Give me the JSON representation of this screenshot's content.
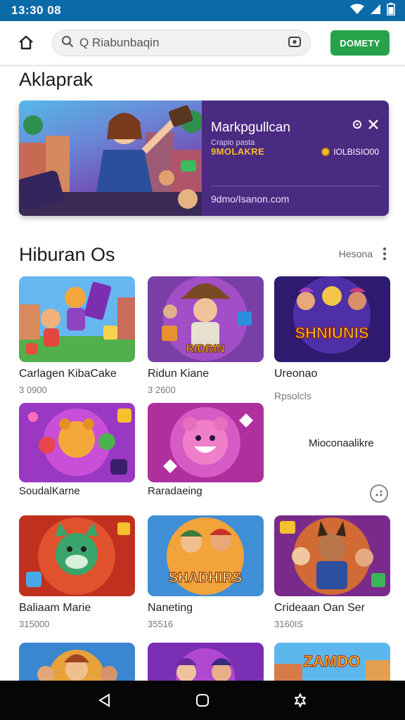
{
  "status_bar": {
    "time": "13:30 08",
    "icons": [
      "wifi-icon",
      "signal-icon",
      "battery-icon"
    ]
  },
  "app_bar": {
    "search_placeholder": "Q Riabunbaqin",
    "action_button": "DOMETY",
    "icons": [
      "home-icon",
      "search-icon",
      "camera-icon"
    ]
  },
  "featured": {
    "section_title": "Aklaprak",
    "title": "Markpgullcan",
    "subtitle": "Crapio pasta",
    "badge": "9MOLAKRE",
    "code": "IOLBISIO00",
    "link": "9dmo/Isanon.com",
    "close_icons": [
      "settings-icon",
      "close-icon"
    ]
  },
  "games_section": {
    "title": "Hiburan Os",
    "more_label": "Hesona",
    "games": [
      {
        "name": "Carlagen KibaCake",
        "sub": "3 0900"
      },
      {
        "name": "Ridun Kiane",
        "sub": "3 2600"
      },
      {
        "name": "Ureonao",
        "sub": ""
      },
      {
        "name": "SoudalKarne",
        "sub": ""
      },
      {
        "name": "Raradaeing",
        "sub": ""
      },
      {
        "name": "Baliaam Marie",
        "sub": "315000"
      },
      {
        "name": "Naneting",
        "sub": "35516"
      },
      {
        "name": "Crideaan Oan Ser",
        "sub": "3160IS"
      }
    ],
    "side_label_1": "Rpsolcls",
    "side_label_2": "Mioconaalikre",
    "thumb_titles": {
      "t2": "RIDBIN",
      "t3": "SHNIUNIS",
      "t7": "SHADHIRS",
      "t11": "ZAMDO"
    }
  },
  "nav_bar": {
    "icons": [
      "back-icon",
      "home-nav-icon",
      "recents-icon"
    ]
  },
  "colors": {
    "status_bar": "#0b6aa8",
    "accent_green": "#27a24a",
    "banner_purple": "#4b2a82",
    "gold": "#f6bd2b"
  }
}
